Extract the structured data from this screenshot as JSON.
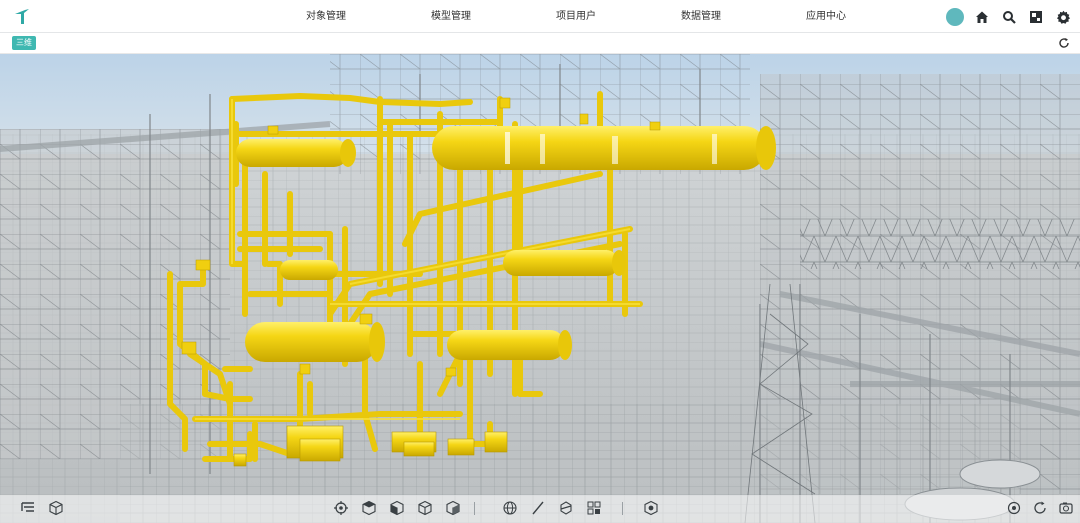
{
  "header": {
    "nav": [
      "对象管理",
      "模型管理",
      "项目用户",
      "数据管理",
      "应用中心"
    ],
    "icons": [
      "home-icon",
      "search-icon",
      "layout-icon",
      "settings-icon"
    ],
    "avatar_color": "#5fb8bd"
  },
  "subbar": {
    "view_badge": "三维",
    "badge_color": "#3fb8b1"
  },
  "viewport": {
    "highlight_color": "#f2d014",
    "background_color": "#d7dadb"
  },
  "toolbar": {
    "left_icons": [
      "tree-icon",
      "cube-icon"
    ],
    "center_icons": [
      "target-icon",
      "cube-icon",
      "cube-icon",
      "cube-icon",
      "cube-icon",
      "globe-icon",
      "measure-icon",
      "section-icon",
      "grid-icon",
      "layer-icon"
    ],
    "right_icons": [
      "settings-icon",
      "rotate-icon",
      "camera-icon"
    ]
  }
}
